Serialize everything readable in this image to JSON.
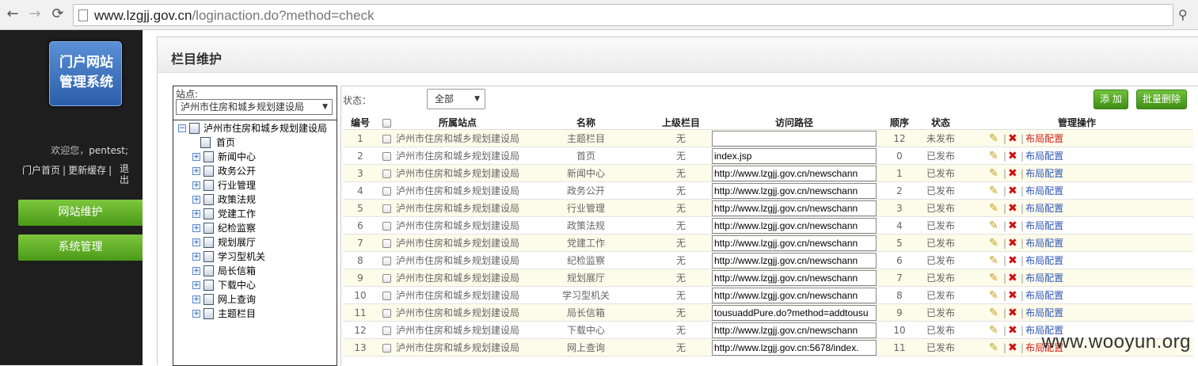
{
  "browser": {
    "url_host": "www.lzgjj.gov.cn",
    "url_path": "/loginaction.do?method=check",
    "back_icon": "arrow-left-icon",
    "forward_icon": "arrow-right-icon",
    "reload_icon": "reload-icon"
  },
  "sidebar": {
    "logo_text": "门户网站\n管理系统",
    "welcome_prefix": "欢迎您，",
    "username": "pentest;",
    "links": [
      "门户首页",
      "|",
      "更新缓存",
      "|"
    ],
    "logout": "退出",
    "menu": [
      "网站维护",
      "系统管理"
    ]
  },
  "main": {
    "title": "栏目维护"
  },
  "tree": {
    "site_label": "站点:",
    "site_selected": "泸州市住房和城乡规划建设局",
    "root": "泸州市住房和城乡规划建设局",
    "nodes": [
      "首页",
      "新闻中心",
      "政务公开",
      "行业管理",
      "政策法规",
      "党建工作",
      "纪检监察",
      "规划展厅",
      "学习型机关",
      "局长信箱",
      "下载中心",
      "网上查询",
      "主题栏目"
    ]
  },
  "filter": {
    "status_label": "状态：",
    "status_selected": "全部",
    "add_button": "添 加",
    "batch_delete_button": "批量删除"
  },
  "table": {
    "headers": {
      "id": "编号",
      "site": "所属站点",
      "name": "名称",
      "parent": "上级栏目",
      "path": "访问路径",
      "order": "顺序",
      "status": "状态",
      "ops": "管理操作"
    },
    "layout_link": "布局配置",
    "rows": [
      {
        "id": "1",
        "site": "泸州市住房和城乡规划建设局",
        "name": "主题栏目",
        "parent": "无",
        "path": "",
        "order": "12",
        "status": "未发布"
      },
      {
        "id": "2",
        "site": "泸州市住房和城乡规划建设局",
        "name": "首页",
        "parent": "无",
        "path": "index.jsp",
        "order": "0",
        "status": "已发布"
      },
      {
        "id": "3",
        "site": "泸州市住房和城乡规划建设局",
        "name": "新闻中心",
        "parent": "无",
        "path": "http://www.lzgjj.gov.cn/newschann",
        "order": "1",
        "status": "已发布"
      },
      {
        "id": "4",
        "site": "泸州市住房和城乡规划建设局",
        "name": "政务公开",
        "parent": "无",
        "path": "http://www.lzgjj.gov.cn/newschann",
        "order": "2",
        "status": "已发布"
      },
      {
        "id": "5",
        "site": "泸州市住房和城乡规划建设局",
        "name": "行业管理",
        "parent": "无",
        "path": "http://www.lzgjj.gov.cn/newschann",
        "order": "3",
        "status": "已发布"
      },
      {
        "id": "6",
        "site": "泸州市住房和城乡规划建设局",
        "name": "政策法规",
        "parent": "无",
        "path": "http://www.lzgjj.gov.cn/newschann",
        "order": "4",
        "status": "已发布"
      },
      {
        "id": "7",
        "site": "泸州市住房和城乡规划建设局",
        "name": "党建工作",
        "parent": "无",
        "path": "http://www.lzgjj.gov.cn/newschann",
        "order": "5",
        "status": "已发布"
      },
      {
        "id": "8",
        "site": "泸州市住房和城乡规划建设局",
        "name": "纪检监察",
        "parent": "无",
        "path": "http://www.lzgjj.gov.cn/newschann",
        "order": "6",
        "status": "已发布"
      },
      {
        "id": "9",
        "site": "泸州市住房和城乡规划建设局",
        "name": "规划展厅",
        "parent": "无",
        "path": "http://www.lzgjj.gov.cn/newschann",
        "order": "7",
        "status": "已发布"
      },
      {
        "id": "10",
        "site": "泸州市住房和城乡规划建设局",
        "name": "学习型机关",
        "parent": "无",
        "path": "http://www.lzgjj.gov.cn/newschann",
        "order": "8",
        "status": "已发布"
      },
      {
        "id": "11",
        "site": "泸州市住房和城乡规划建设局",
        "name": "局长信箱",
        "parent": "无",
        "path": "tousuaddPure.do?method=addtousu",
        "order": "9",
        "status": "已发布"
      },
      {
        "id": "12",
        "site": "泸州市住房和城乡规划建设局",
        "name": "下载中心",
        "parent": "无",
        "path": "http://www.lzgjj.gov.cn/newschann",
        "order": "10",
        "status": "已发布"
      },
      {
        "id": "13",
        "site": "泸州市住房和城乡规划建设局",
        "name": "网上查询",
        "parent": "无",
        "path": "http://www.lzgjj.gov.cn:5678/index.",
        "order": "11",
        "status": "已发布"
      }
    ]
  },
  "watermark": "www.wooyun.org",
  "colors": {
    "accent_green": "#5aad25",
    "link_blue": "#2f56b5",
    "delete_red": "#cc1111"
  }
}
